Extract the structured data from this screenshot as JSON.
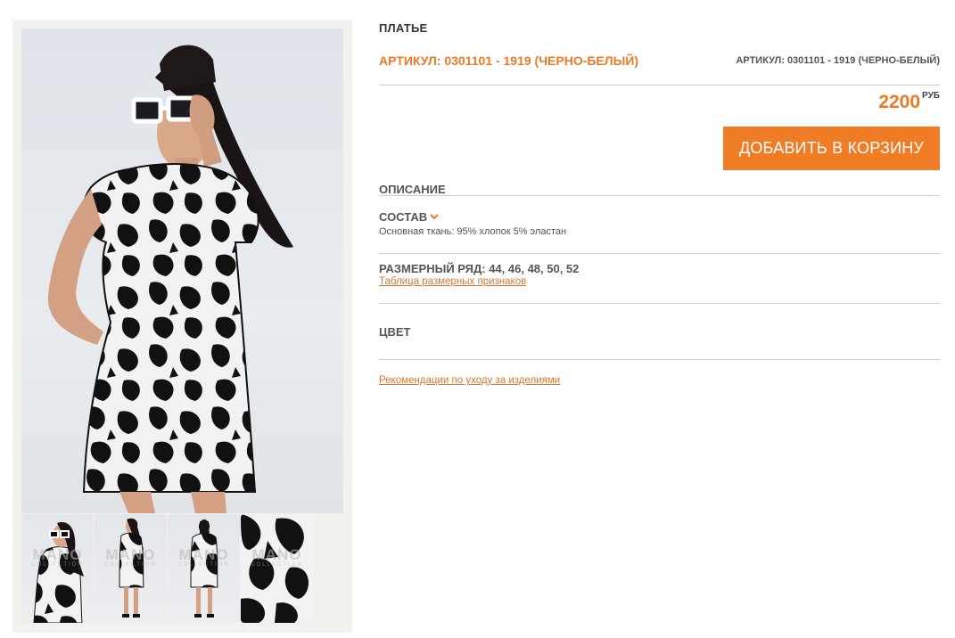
{
  "product": {
    "type": "ПЛАТЬЕ",
    "sku": "АРТИКУЛ: 0301101 - 1919 (ЧЕРНО-БЕЛЫЙ)",
    "sku_secondary": "АРТИКУЛ: 0301101 - 1919 (ЧЕРНО-БЕЛЫЙ)",
    "price": "2200",
    "currency": "РУБ"
  },
  "actions": {
    "add_to_cart": "ДОБАВИТЬ В КОРЗИНУ"
  },
  "description": {
    "title": "ОПИСАНИЕ",
    "composition_title": "СОСТАВ",
    "composition_text": "Основная ткань: 95% хлопок 5% эластан",
    "sizes_title": "РАЗМЕРНЫЙ РЯД: 44, 46, 48, 50, 52",
    "size_chart_link": "Таблица размерных признаков",
    "color_title": "ЦВЕТ",
    "care_link": "Рекомендации по уходу за изделиями"
  },
  "gallery": {
    "watermark": "MANO",
    "watermark_sub": "COLLECTION",
    "thumbnail_count": 4
  },
  "colors": {
    "accent": "#f07c26",
    "dress_black": "#111111",
    "dress_white": "#f2f2f2"
  }
}
